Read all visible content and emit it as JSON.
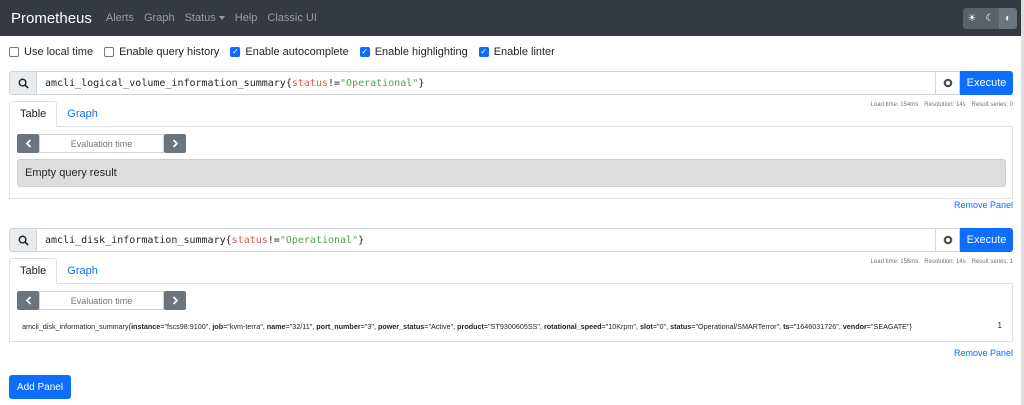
{
  "nav": {
    "brand": "Prometheus",
    "links": [
      "Alerts",
      "Graph",
      "Status",
      "Help",
      "Classic UI"
    ]
  },
  "theme_toggle": {
    "icons": [
      "sun-icon",
      "moon-icon",
      "contrast-icon"
    ],
    "glyphs": [
      "☀",
      "☾",
      "◐"
    ]
  },
  "options": [
    {
      "label": "Use local time",
      "checked": false
    },
    {
      "label": "Enable query history",
      "checked": false
    },
    {
      "label": "Enable autocomplete",
      "checked": true
    },
    {
      "label": "Enable highlighting",
      "checked": true
    },
    {
      "label": "Enable linter",
      "checked": true
    }
  ],
  "panels": [
    {
      "expr_metric": "amcli_logical_volume_information_summary",
      "expr_label": "status",
      "expr_op": "!=",
      "expr_value": "\"Operational\"",
      "execute_label": "Execute",
      "stats": {
        "load_time": "Load time: 154ms",
        "resolution": "Resolution: 14s",
        "result_series": "Result series: 0"
      },
      "tabs": [
        "Table",
        "Graph"
      ],
      "eval_placeholder": "Evaluation time",
      "empty_text": "Empty query result",
      "remove_label": "Remove Panel"
    },
    {
      "expr_metric": "amcli_disk_information_summary",
      "expr_label": "status",
      "expr_op": "!=",
      "expr_value": "\"Operational\"",
      "execute_label": "Execute",
      "stats": {
        "load_time": "Load time: 156ms",
        "resolution": "Resolution: 14s",
        "result_series": "Result series: 1"
      },
      "tabs": [
        "Table",
        "Graph"
      ],
      "eval_placeholder": "Evaluation time",
      "result": {
        "metric": "amcli_disk_information_summary",
        "labels": [
          {
            "k": "instance",
            "v": "\"fscs98:9100\""
          },
          {
            "k": "job",
            "v": "\"kvm-terra\""
          },
          {
            "k": "name",
            "v": "\"32/11\""
          },
          {
            "k": "port_number",
            "v": "\"3\""
          },
          {
            "k": "power_status",
            "v": "\"Active\""
          },
          {
            "k": "product",
            "v": "\"ST9300605SS\""
          },
          {
            "k": "rotational_speed",
            "v": "\"10Krpm\""
          },
          {
            "k": "slot",
            "v": "\"0\""
          },
          {
            "k": "status",
            "v": "\"Operational/SMARTerror\""
          },
          {
            "k": "ts",
            "v": "\"1646031726\""
          },
          {
            "k": "vendor",
            "v": "\"SEAGATE\""
          }
        ],
        "value": "1"
      },
      "remove_label": "Remove Panel"
    }
  ],
  "add_panel_label": "Add Panel"
}
